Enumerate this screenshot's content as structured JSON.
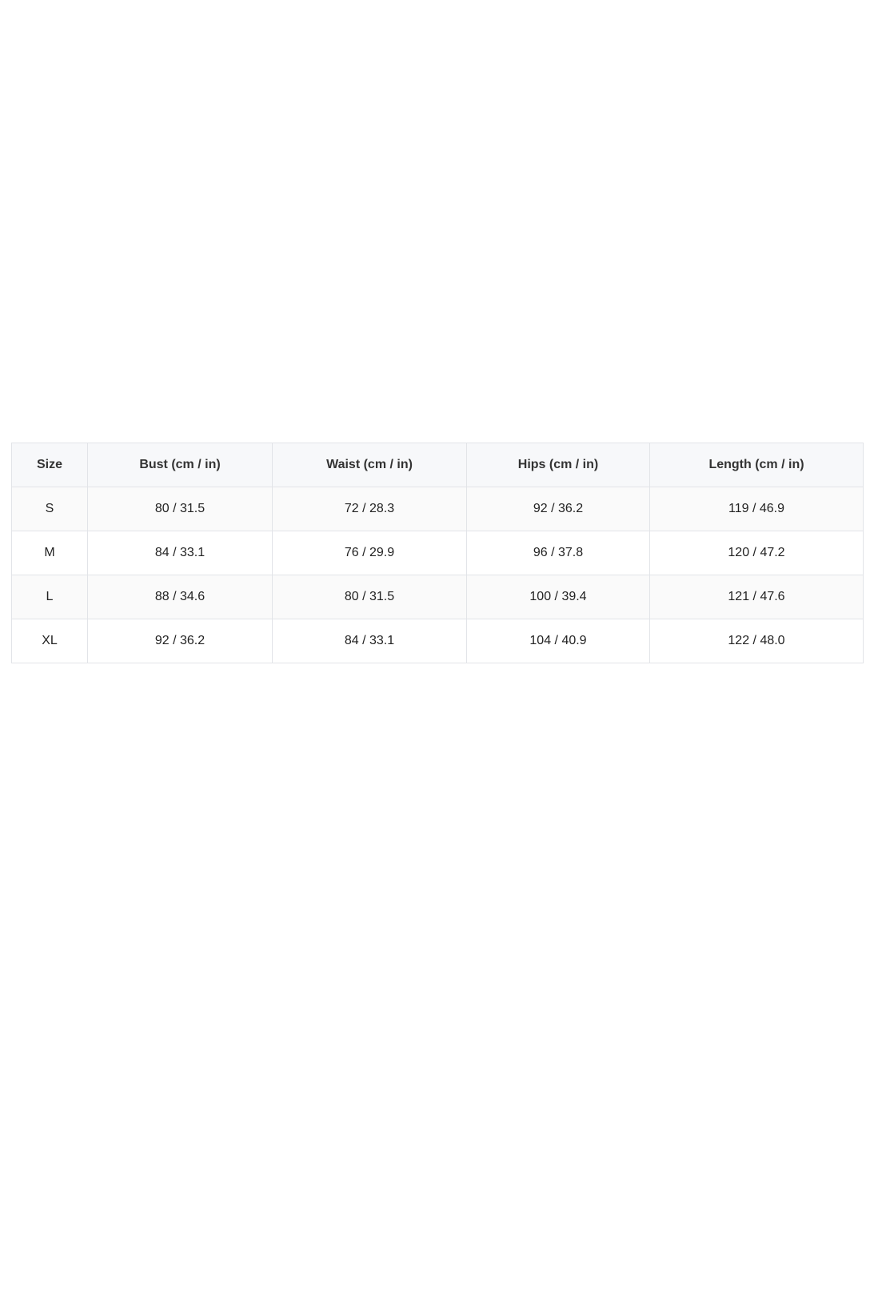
{
  "size_chart": {
    "columns": [
      "Size",
      "Bust (cm / in)",
      "Waist (cm / in)",
      "Hips (cm / in)",
      "Length (cm / in)"
    ],
    "rows": [
      [
        "S",
        "80 / 31.5",
        "72 / 28.3",
        "92 / 36.2",
        "119 / 46.9"
      ],
      [
        "M",
        "84 / 33.1",
        "76 / 29.9",
        "96 / 37.8",
        "120 / 47.2"
      ],
      [
        "L",
        "88 / 34.6",
        "80 / 31.5",
        "100 / 39.4",
        "121 / 47.6"
      ],
      [
        "XL",
        "92 / 36.2",
        "84 / 33.1",
        "104 / 40.9",
        "122 / 48.0"
      ]
    ]
  },
  "colors": {
    "header_background": "#f7f8fa",
    "border": "#e2e4e8",
    "stripe": "#fafafa",
    "text": "#222222"
  }
}
